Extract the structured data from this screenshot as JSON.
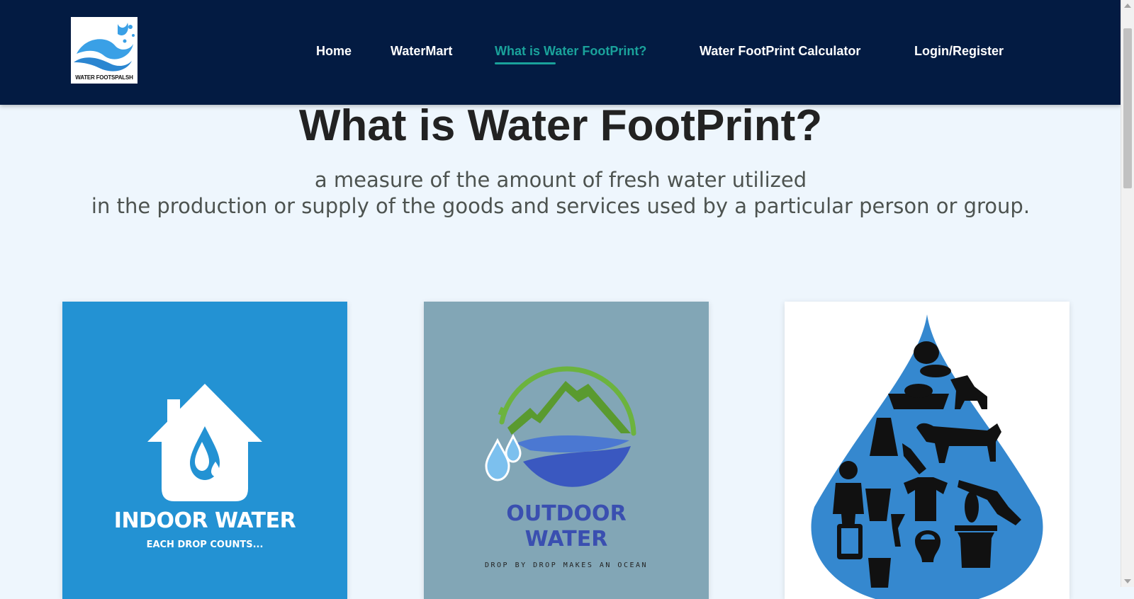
{
  "brand": {
    "logo_text": "WATER FOOTSPALSH"
  },
  "nav": {
    "items": [
      {
        "label": "Home",
        "active": false
      },
      {
        "label": "WaterMart",
        "active": false
      },
      {
        "label": "What is Water FootPrint?",
        "active": true
      },
      {
        "label": "Water FootPrint Calculator",
        "active": false
      },
      {
        "label": "Login/Register",
        "active": false
      }
    ]
  },
  "hero": {
    "title": "What is Water FootPrint?",
    "definition_line1": "a measure of the amount of fresh water utilized",
    "definition_line2": "in the production or supply of the goods and services used by a particular person or group."
  },
  "cards": [
    {
      "title": "INDOOR WATER",
      "subtitle": "EACH DROP COUNTS...",
      "icon": "house-drop-icon"
    },
    {
      "title_line1": "OUTDOOR",
      "title_line2": "WATER",
      "subtitle": "DROP BY DROP MAKES AN OCEAN",
      "icon": "mountain-water-icon"
    },
    {
      "icon": "water-drop-consumer-goods-icon"
    }
  ],
  "colors": {
    "navbar": "#031b42",
    "active_link": "#1aa29b",
    "page_background": "#eef6fd",
    "indoor_card": "#2392d3",
    "outdoor_card": "#82a6b6"
  }
}
